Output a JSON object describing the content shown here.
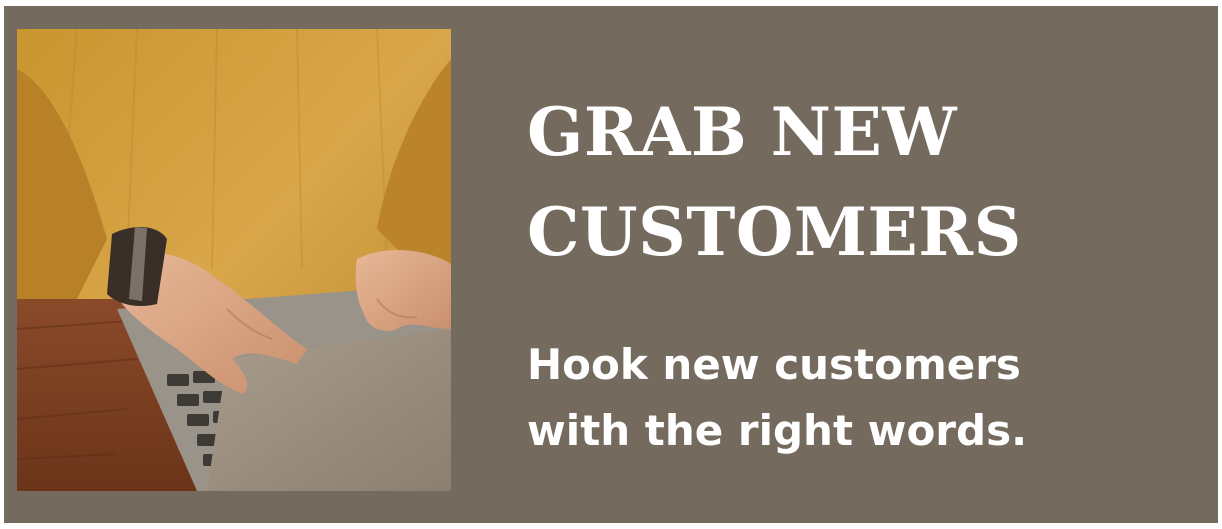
{
  "banner": {
    "headline_line1": "GRAB NEW",
    "headline_line2": "CUSTOMERS",
    "subline_line1": "Hook new customers",
    "subline_line2": "with the right words.",
    "background_color": "#756a5e",
    "text_color": "#ffffff"
  },
  "photo": {
    "icon": "typing-on-laptop-photo"
  }
}
